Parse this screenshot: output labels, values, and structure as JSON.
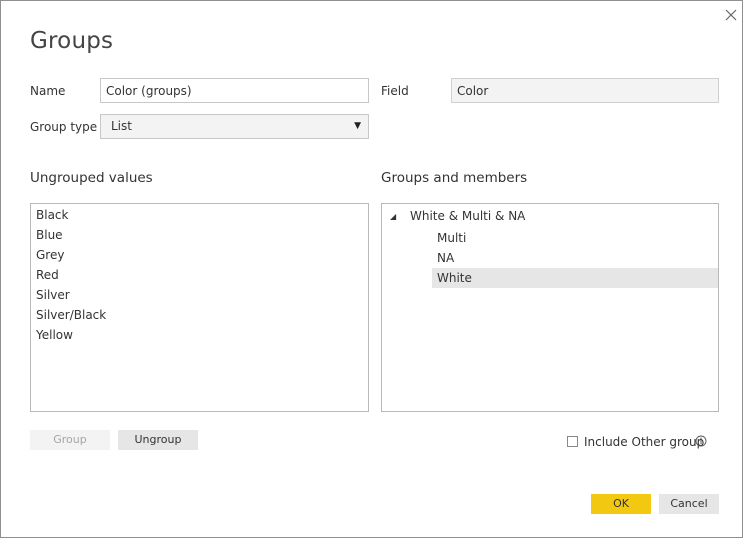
{
  "dialog": {
    "title": "Groups",
    "close_icon": "close-icon"
  },
  "form": {
    "name_label": "Name",
    "name_value": "Color (groups)",
    "field_label": "Field",
    "field_value": "Color",
    "group_type_label": "Group type",
    "group_type_value": "List"
  },
  "ungrouped": {
    "title": "Ungrouped values",
    "items": [
      "Black",
      "Blue",
      "Grey",
      "Red",
      "Silver",
      "Silver/Black",
      "Yellow"
    ]
  },
  "groups": {
    "title": "Groups and members",
    "group_name": "White & Multi & NA",
    "members": [
      "Multi",
      "NA",
      "White"
    ],
    "selected_member": "White"
  },
  "buttons": {
    "group": "Group",
    "ungroup": "Ungroup",
    "ok": "OK",
    "cancel": "Cancel"
  },
  "options": {
    "include_other_label": "Include Other group",
    "include_other_checked": false,
    "info_icon": "info-icon"
  },
  "colors": {
    "primary_button": "#f2c811",
    "selected_row": "#e6e6e6",
    "disabled_text": "#a6a6a6"
  }
}
